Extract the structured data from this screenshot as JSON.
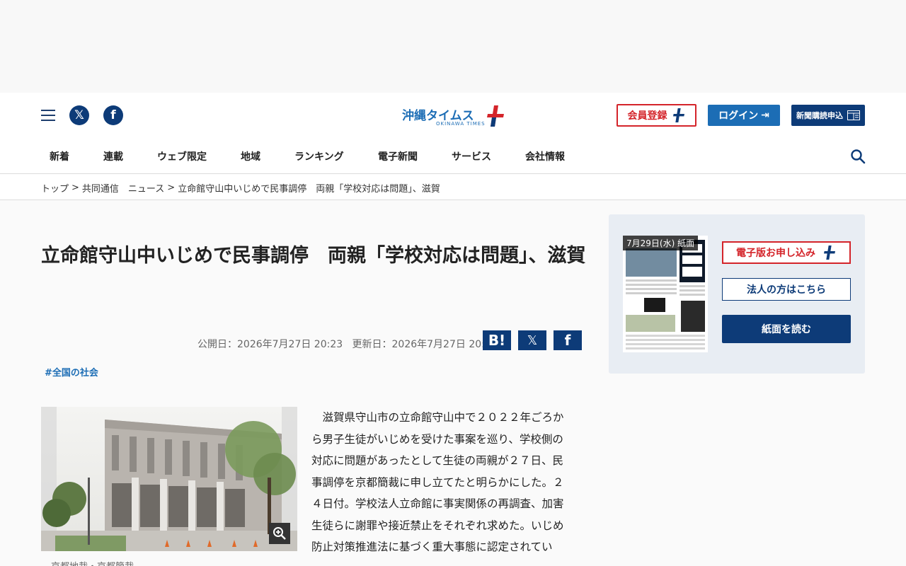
{
  "header": {
    "logo_text": "沖縄タイムス",
    "logo_sub": "OKINAWA TIMES",
    "logo_plus": "プラス",
    "register_label": "会員登録",
    "login_label": "ログイン",
    "subscribe_label": "新聞購読申込",
    "colors": {
      "brand": "#1c6db5",
      "navy": "#0d3b78",
      "red": "#d4242a"
    }
  },
  "nav": {
    "items": [
      "新着",
      "連載",
      "ウェブ限定",
      "地域",
      "ランキング",
      "電子新聞",
      "サービス",
      "会社情報"
    ]
  },
  "breadcrumb": {
    "items": [
      "トップ",
      "共同通信　ニュース",
      "立命館守山中いじめで民事調停　両親「学校対応は問題」、滋賀"
    ],
    "sep": ">"
  },
  "article": {
    "title": "立命館守山中いじめで民事調停　両親「学校対応は問題」、滋賀",
    "published": "公開日：2026年7月27日 20:23",
    "updated": "更新日：2026年7月27日 20:25",
    "hatena_label": "B!",
    "tag": "#全国の社会",
    "caption": "京都地裁・京都簡裁",
    "body": "滋賀県守山市の立命館守山中で２０２２年ごろから男子生徒がいじめを受けた事案を巡り、学校側の対応に問題があったとして生徒の両親が２７日、民事調停を京都簡裁に申し立てたと明らかにした。２４日付。学校法人立命館に事実関係の再調査、加害生徒らに謝罪や接近禁止をそれぞれ求めた。いじめ防止対策推進法に基づく重大事態に認定されてい"
  },
  "sidebar": {
    "paper_date": "7月29日(水) 紙面",
    "digital_apply_label": "電子版お申し込み",
    "corporate_label": "法人の方はこちら",
    "read_paper_label": "紙面を読む"
  }
}
